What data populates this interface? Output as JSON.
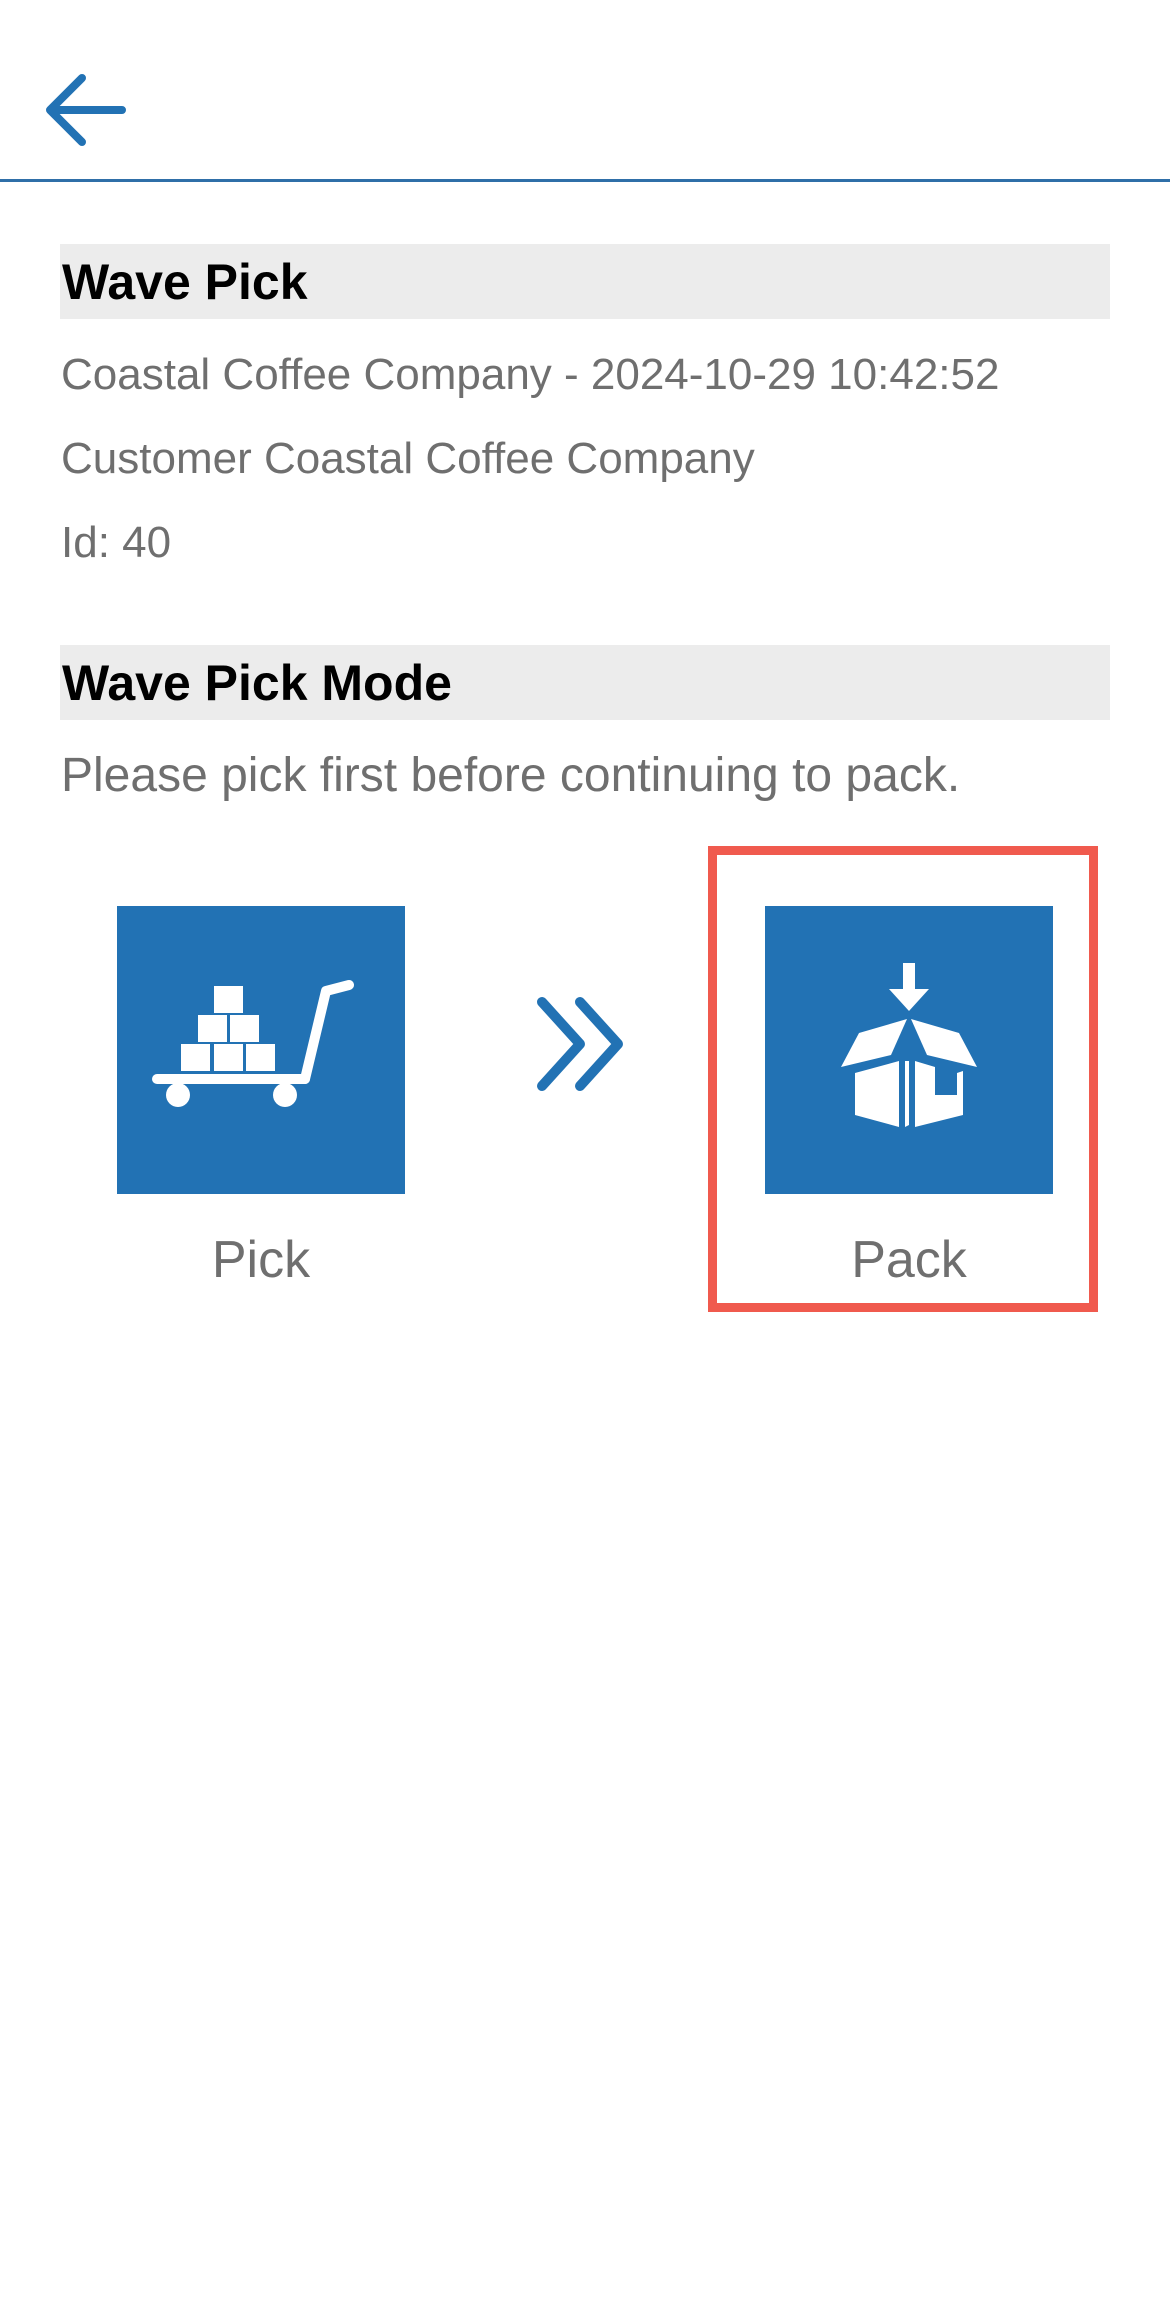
{
  "header": {
    "back_icon": "arrow-left-icon",
    "accent_color": "#2272b4"
  },
  "wave_pick": {
    "title": "Wave Pick",
    "name_line": "Coastal Coffee Company - 2024-10-29 10:42:52",
    "customer_line": "Customer Coastal Coffee Company",
    "id_line": "Id: 40"
  },
  "mode": {
    "title": "Wave Pick Mode",
    "instruction": "Please pick first before continuing to pack.",
    "steps": [
      {
        "label": "Pick",
        "icon": "cart-boxes-icon"
      },
      {
        "label": "Pack",
        "icon": "open-box-icon"
      }
    ],
    "separator_icon": "double-chevron-right-icon",
    "highlight_color": "#f05a4e"
  }
}
